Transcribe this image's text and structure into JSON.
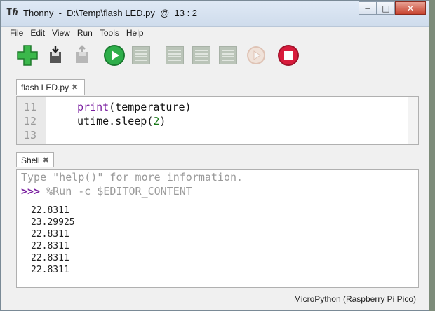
{
  "window": {
    "title": "Thonny  -  D:\\Temp\\flash LED.py  @  13 : 2",
    "controls": {
      "minimize": "−",
      "maximize": "□",
      "close": "✕"
    }
  },
  "menu": [
    "File",
    "Edit",
    "View",
    "Run",
    "Tools",
    "Help"
  ],
  "toolbar": [
    {
      "name": "new-file",
      "icon": "plus-icon",
      "enabled": true
    },
    {
      "name": "open-file",
      "icon": "open-icon",
      "enabled": true
    },
    {
      "name": "save-file",
      "icon": "save-icon",
      "enabled": false
    },
    {
      "name": "run",
      "icon": "play-icon",
      "enabled": true,
      "color": "#2eae4a"
    },
    {
      "name": "debug",
      "icon": "debug-icon",
      "enabled": false
    },
    {
      "name": "step-over",
      "icon": "step-over-icon",
      "enabled": false
    },
    {
      "name": "step-into",
      "icon": "step-into-icon",
      "enabled": false
    },
    {
      "name": "step-out",
      "icon": "step-out-icon",
      "enabled": false
    },
    {
      "name": "resume",
      "icon": "resume-icon",
      "enabled": false
    },
    {
      "name": "stop",
      "icon": "stop-icon",
      "enabled": true,
      "color": "#d81b3c"
    }
  ],
  "editor": {
    "tab_label": "flash LED.py",
    "tab_close": "✖",
    "lines": [
      {
        "num": "11",
        "fn": "print",
        "rest": "(temperature)",
        "arg": ""
      },
      {
        "num": "12",
        "fn": "",
        "rest": "utime.sleep(",
        "arg": "2",
        "end": ")"
      },
      {
        "num": "13",
        "fn": "",
        "rest": "",
        "arg": ""
      }
    ]
  },
  "shell": {
    "tab_label": "Shell",
    "tab_close": "✖",
    "intro": "Type \"help()\" for more information.",
    "prompt": ">>>",
    "command": "%Run -c $EDITOR_CONTENT",
    "output": [
      "22.8311",
      "23.29925",
      "22.8311",
      "22.8311",
      "22.8311",
      "22.8311"
    ]
  },
  "status": {
    "interpreter": "MicroPython (Raspberry Pi Pico)"
  },
  "colors": {
    "prompt": "#7a1fa0",
    "intro": "#9a9a9a",
    "command": "#9a9a9a"
  }
}
